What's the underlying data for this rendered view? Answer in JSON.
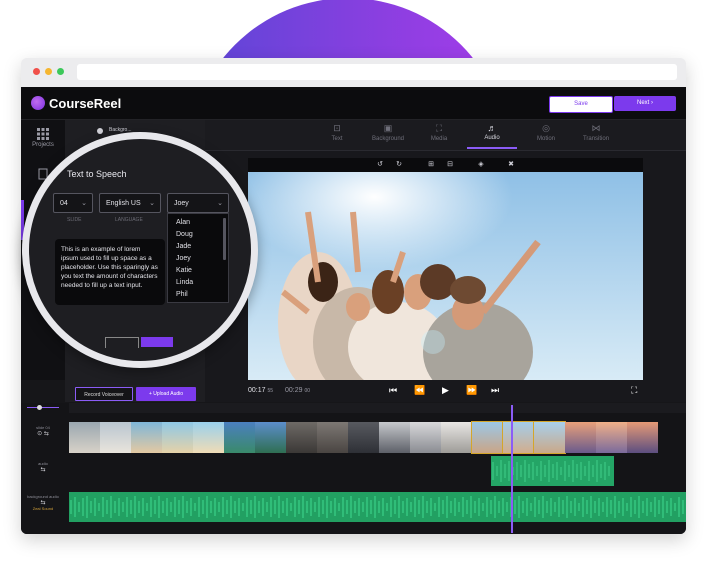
{
  "app": {
    "title": "CourseReel",
    "save_label": "Save",
    "next_label": "Next",
    "next_icon": "›"
  },
  "leftnav": {
    "projects_label": "Projects"
  },
  "tabs": [
    {
      "label": "Text",
      "icon": "text-icon"
    },
    {
      "label": "Background",
      "icon": "background-icon"
    },
    {
      "label": "Media",
      "icon": "media-icon"
    },
    {
      "label": "Audio",
      "icon": "audio-icon",
      "active": true
    },
    {
      "label": "Motion",
      "icon": "motion-icon"
    },
    {
      "label": "Transition",
      "icon": "transition-icon"
    }
  ],
  "panel": {
    "header": "Backgro..."
  },
  "tts": {
    "title": "Text to Speech",
    "slide_value": "04",
    "slide_label": "SLIDE",
    "language_value": "English US",
    "language_label": "LANGUAGE",
    "voice_value": "Joey",
    "voices": [
      "Alan",
      "Doug",
      "Jade",
      "Joey",
      "Katie",
      "Linda",
      "Phil"
    ],
    "sample_text": "This is an example of lorem ipsum used to fill up space as a placeholder. Use this sparingly as you text the amount of characters needed to fill up a text input."
  },
  "buttons": {
    "record_label": "Record Voiceover",
    "upload_label": "+ Upload Audio"
  },
  "player": {
    "current_time": "00:17",
    "current_frame": "55",
    "total_time": "00:29",
    "total_frame": "00"
  },
  "timeline": {
    "track1_label": "slide 04",
    "track2_label": "audio",
    "track3_label": "background audio",
    "track3_sub": "Zeal Sound"
  },
  "colors": {
    "accent": "#7c3aed",
    "audio": "#24a566"
  }
}
